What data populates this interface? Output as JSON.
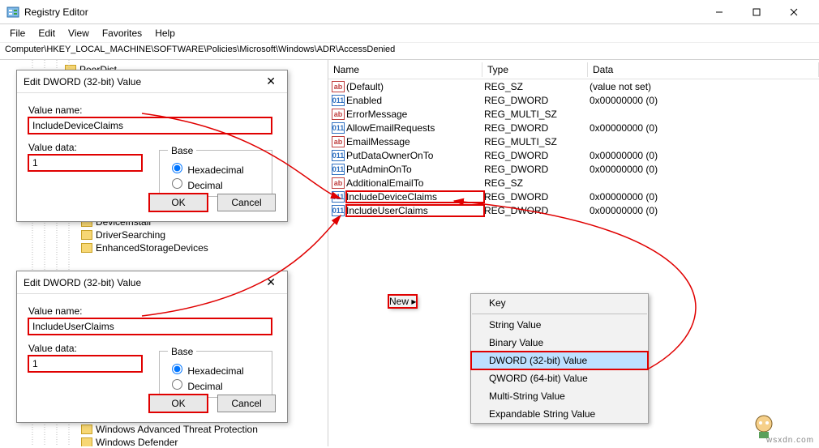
{
  "window": {
    "title": "Registry Editor"
  },
  "menubar": [
    "File",
    "Edit",
    "View",
    "Favorites",
    "Help"
  ],
  "address": "Computer\\HKEY_LOCAL_MACHINE\\SOFTWARE\\Policies\\Microsoft\\Windows\\ADR\\AccessDenied",
  "columns": {
    "name": "Name",
    "type": "Type",
    "data": "Data"
  },
  "rows": [
    {
      "icon": "ab",
      "name": "(Default)",
      "type": "REG_SZ",
      "data": "(value not set)"
    },
    {
      "icon": "011",
      "name": "Enabled",
      "type": "REG_DWORD",
      "data": "0x00000000 (0)"
    },
    {
      "icon": "ab",
      "name": "ErrorMessage",
      "type": "REG_MULTI_SZ",
      "data": ""
    },
    {
      "icon": "011",
      "name": "AllowEmailRequests",
      "type": "REG_DWORD",
      "data": "0x00000000 (0)"
    },
    {
      "icon": "ab",
      "name": "EmailMessage",
      "type": "REG_MULTI_SZ",
      "data": ""
    },
    {
      "icon": "011",
      "name": "PutDataOwnerOnTo",
      "type": "REG_DWORD",
      "data": "0x00000000 (0)"
    },
    {
      "icon": "011",
      "name": "PutAdminOnTo",
      "type": "REG_DWORD",
      "data": "0x00000000 (0)"
    },
    {
      "icon": "ab",
      "name": "AdditionalEmailTo",
      "type": "REG_SZ",
      "data": ""
    },
    {
      "icon": "011",
      "name": "IncludeDeviceClaims",
      "type": "REG_DWORD",
      "data": "0x00000000 (0)",
      "hl": true
    },
    {
      "icon": "011",
      "name": "IncludeUserClaims",
      "type": "REG_DWORD",
      "data": "0x00000000 (0)",
      "hl": true
    }
  ],
  "tree_visible": [
    "PeerDist",
    "DeviceInstall",
    "DriverSearching",
    "EnhancedStorageDevices",
    "Windows Advanced Threat Protection",
    "Windows Defender"
  ],
  "dialog1": {
    "title": "Edit DWORD (32-bit) Value",
    "lbl_name": "Value name:",
    "val_name": "IncludeDeviceClaims",
    "lbl_data": "Value data:",
    "val_data": "1",
    "grp": "Base",
    "opt_hex": "Hexadecimal",
    "opt_dec": "Decimal",
    "ok": "OK",
    "cancel": "Cancel"
  },
  "dialog2": {
    "title": "Edit DWORD (32-bit) Value",
    "lbl_name": "Value name:",
    "val_name": "IncludeUserClaims",
    "lbl_data": "Value data:",
    "val_data": "1",
    "grp": "Base",
    "opt_hex": "Hexadecimal",
    "opt_dec": "Decimal",
    "ok": "OK",
    "cancel": "Cancel"
  },
  "context": {
    "parent": "New",
    "items": [
      "Key",
      "String Value",
      "Binary Value",
      "DWORD (32-bit) Value",
      "QWORD (64-bit) Value",
      "Multi-String Value",
      "Expandable String Value"
    ],
    "highlighted": "DWORD (32-bit) Value"
  },
  "watermark": "wsxdn.com"
}
